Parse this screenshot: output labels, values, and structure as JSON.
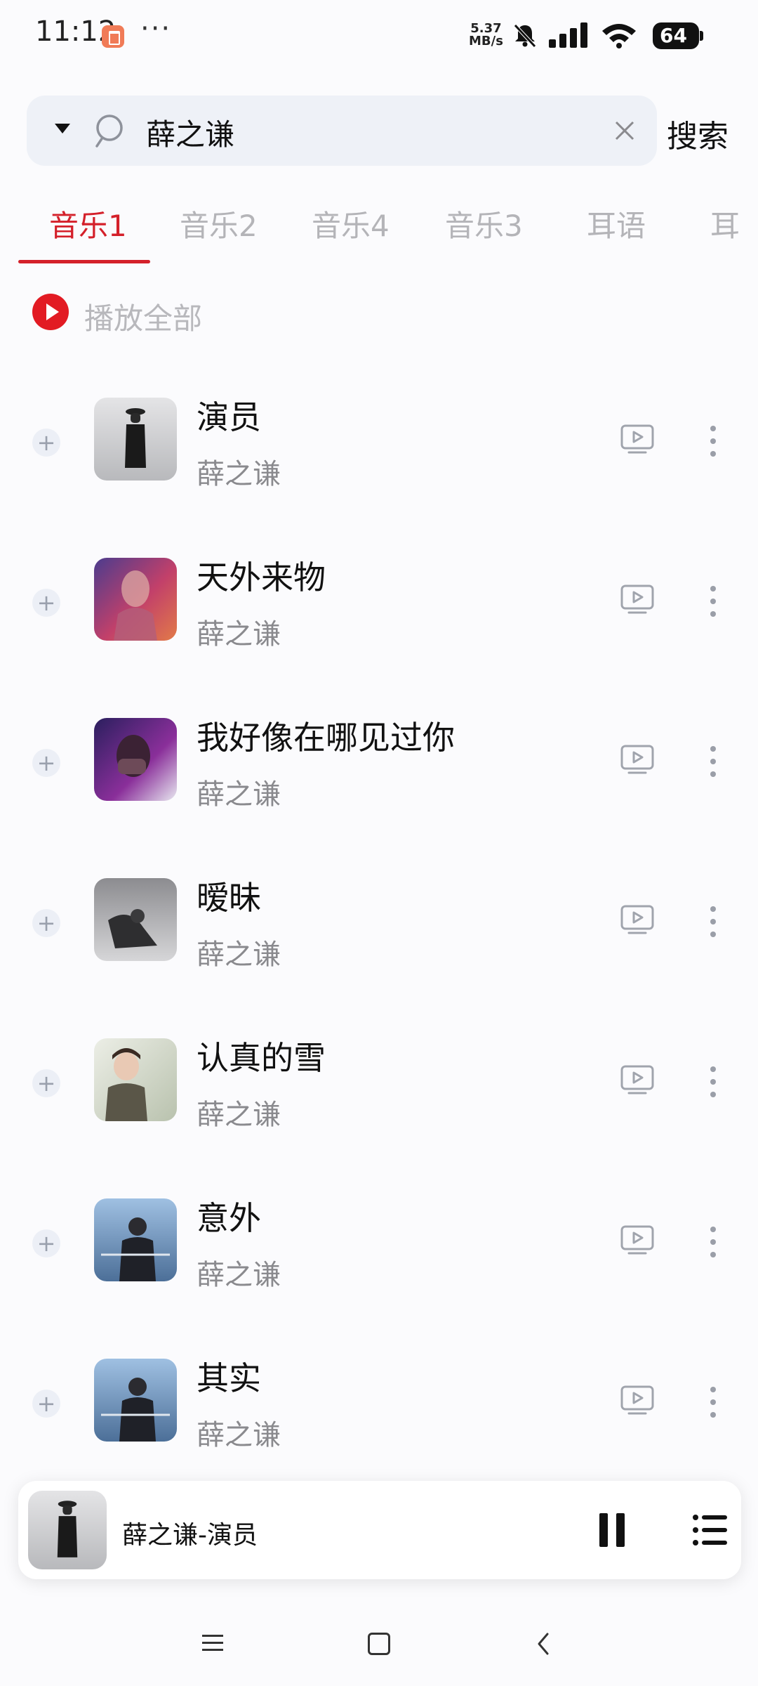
{
  "status_bar": {
    "time": "11:12",
    "dots": "···",
    "speed_value": "5.37",
    "speed_unit": "MB/s",
    "battery": "64"
  },
  "search": {
    "query": "薛之谦",
    "button_label": "搜索"
  },
  "tabs": [
    {
      "label": "音乐1",
      "active": true
    },
    {
      "label": "音乐2",
      "active": false
    },
    {
      "label": "音乐4",
      "active": false
    },
    {
      "label": "音乐3",
      "active": false
    },
    {
      "label": "耳语",
      "active": false
    },
    {
      "label": "耳",
      "active": false
    }
  ],
  "play_all": {
    "label": "播放全部"
  },
  "songs": [
    {
      "title": "演员",
      "artist": "薛之谦",
      "cover_color": "#cfd0d2"
    },
    {
      "title": "天外来物",
      "artist": "薛之谦",
      "cover_color": "#8a3f7c"
    },
    {
      "title": "我好像在哪见过你",
      "artist": "薛之谦",
      "cover_color": "#3a2a6e"
    },
    {
      "title": "暧昧",
      "artist": "薛之谦",
      "cover_color": "#6e6e72"
    },
    {
      "title": "认真的雪",
      "artist": "薛之谦",
      "cover_color": "#a8b0a0"
    },
    {
      "title": "意外",
      "artist": "薛之谦",
      "cover_color": "#6a8fb8"
    },
    {
      "title": "其实",
      "artist": "薛之谦",
      "cover_color": "#6a8fb8"
    }
  ],
  "mini_player": {
    "now_playing": "薛之谦-演员"
  },
  "colors": {
    "accent": "#d4202a",
    "background": "#fbfbfd"
  }
}
